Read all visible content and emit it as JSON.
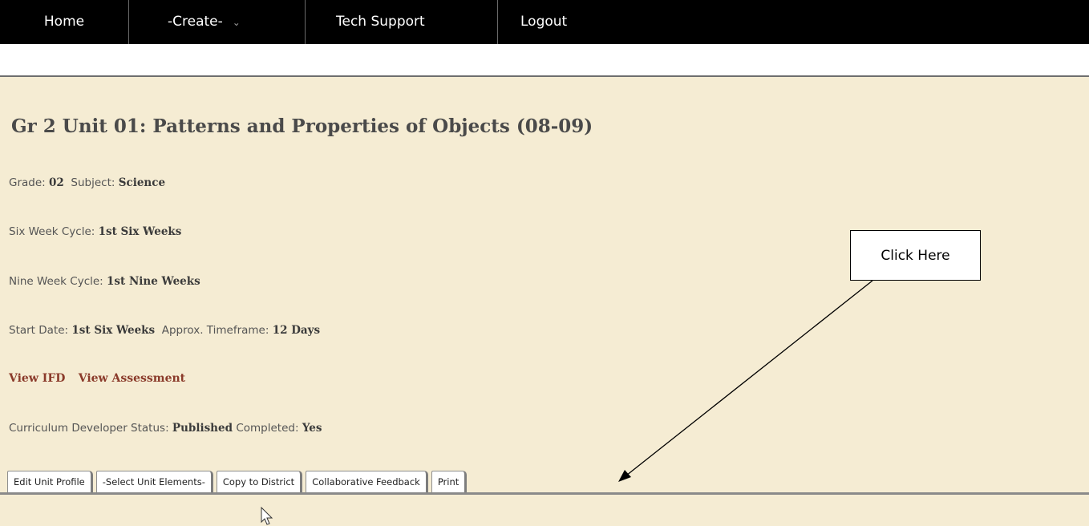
{
  "nav": {
    "home": "Home",
    "create": "-Create-",
    "tech_support": "Tech Support",
    "logout": "Logout"
  },
  "unit": {
    "title": "Gr 2 Unit 01: Patterns and Properties of Objects (08-09)",
    "grade_label": "Grade:",
    "grade_value": "02",
    "subject_label": "Subject:",
    "subject_value": "Science",
    "six_week_label": "Six Week Cycle:",
    "six_week_value": "1st Six Weeks",
    "nine_week_label": "Nine Week Cycle:",
    "nine_week_value": "1st Nine Weeks",
    "start_date_label": "Start Date:",
    "start_date_value": "1st Six Weeks",
    "timeframe_label": "Approx. Timeframe:",
    "timeframe_value": "12 Days",
    "view_ifd": "View IFD",
    "view_assessment": "View Assessment",
    "status_label": "Curriculum Developer Status:",
    "status_value": "Published",
    "completed_label": "Completed:",
    "completed_value": "Yes"
  },
  "tabs": [
    "Edit Unit Profile",
    "-Select Unit Elements-",
    "Copy to District",
    "Collaborative Feedback",
    "Print"
  ],
  "callout": "Click Here",
  "icons": {
    "chevron": "chevron-down-icon",
    "arrow": "annotation-arrow",
    "cursor": "mouse-pointer-icon"
  },
  "colors": {
    "nav_bg": "#000000",
    "content_bg": "#f5ecd3",
    "link": "#8a3a2a"
  }
}
